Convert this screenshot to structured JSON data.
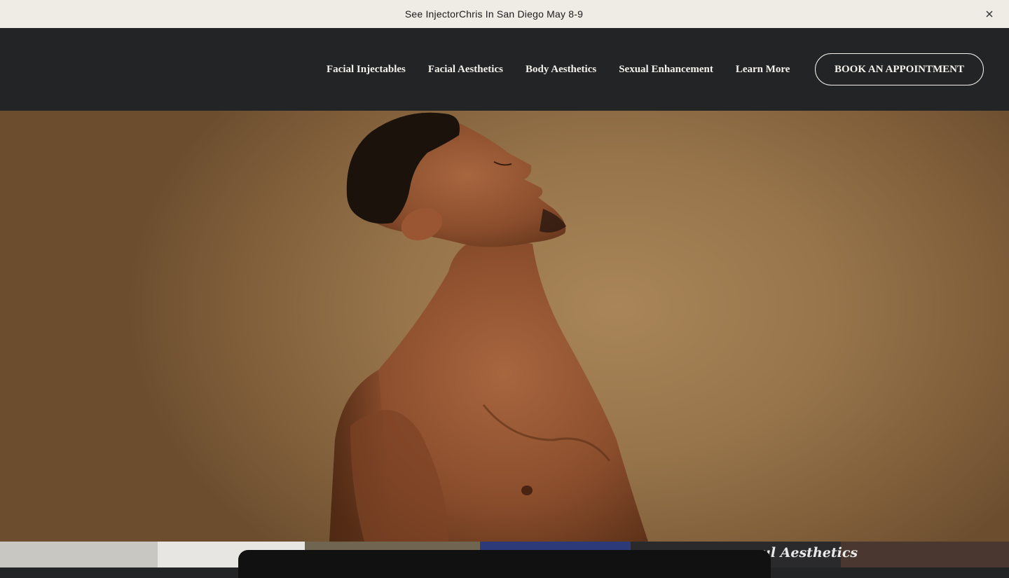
{
  "announcement": {
    "text": "See InjectorChris In San Diego May 8-9",
    "close_icon": "close-icon"
  },
  "nav": {
    "items": [
      {
        "label": "Facial Injectables"
      },
      {
        "label": "Facial Aesthetics"
      },
      {
        "label": "Body Aesthetics"
      },
      {
        "label": "Sexual Enhancement"
      },
      {
        "label": "Learn More"
      }
    ],
    "cta_label": "BOOK AN APPOINTMENT"
  },
  "hero": {
    "image": "man-profile-photo"
  },
  "strip": {
    "script_text": "ul Aesthetics"
  },
  "colors": {
    "announcement_bg": "#efebe5",
    "header_bg": "#232425",
    "header_text": "#f4f1ec",
    "hero_bg": "#97744a"
  }
}
